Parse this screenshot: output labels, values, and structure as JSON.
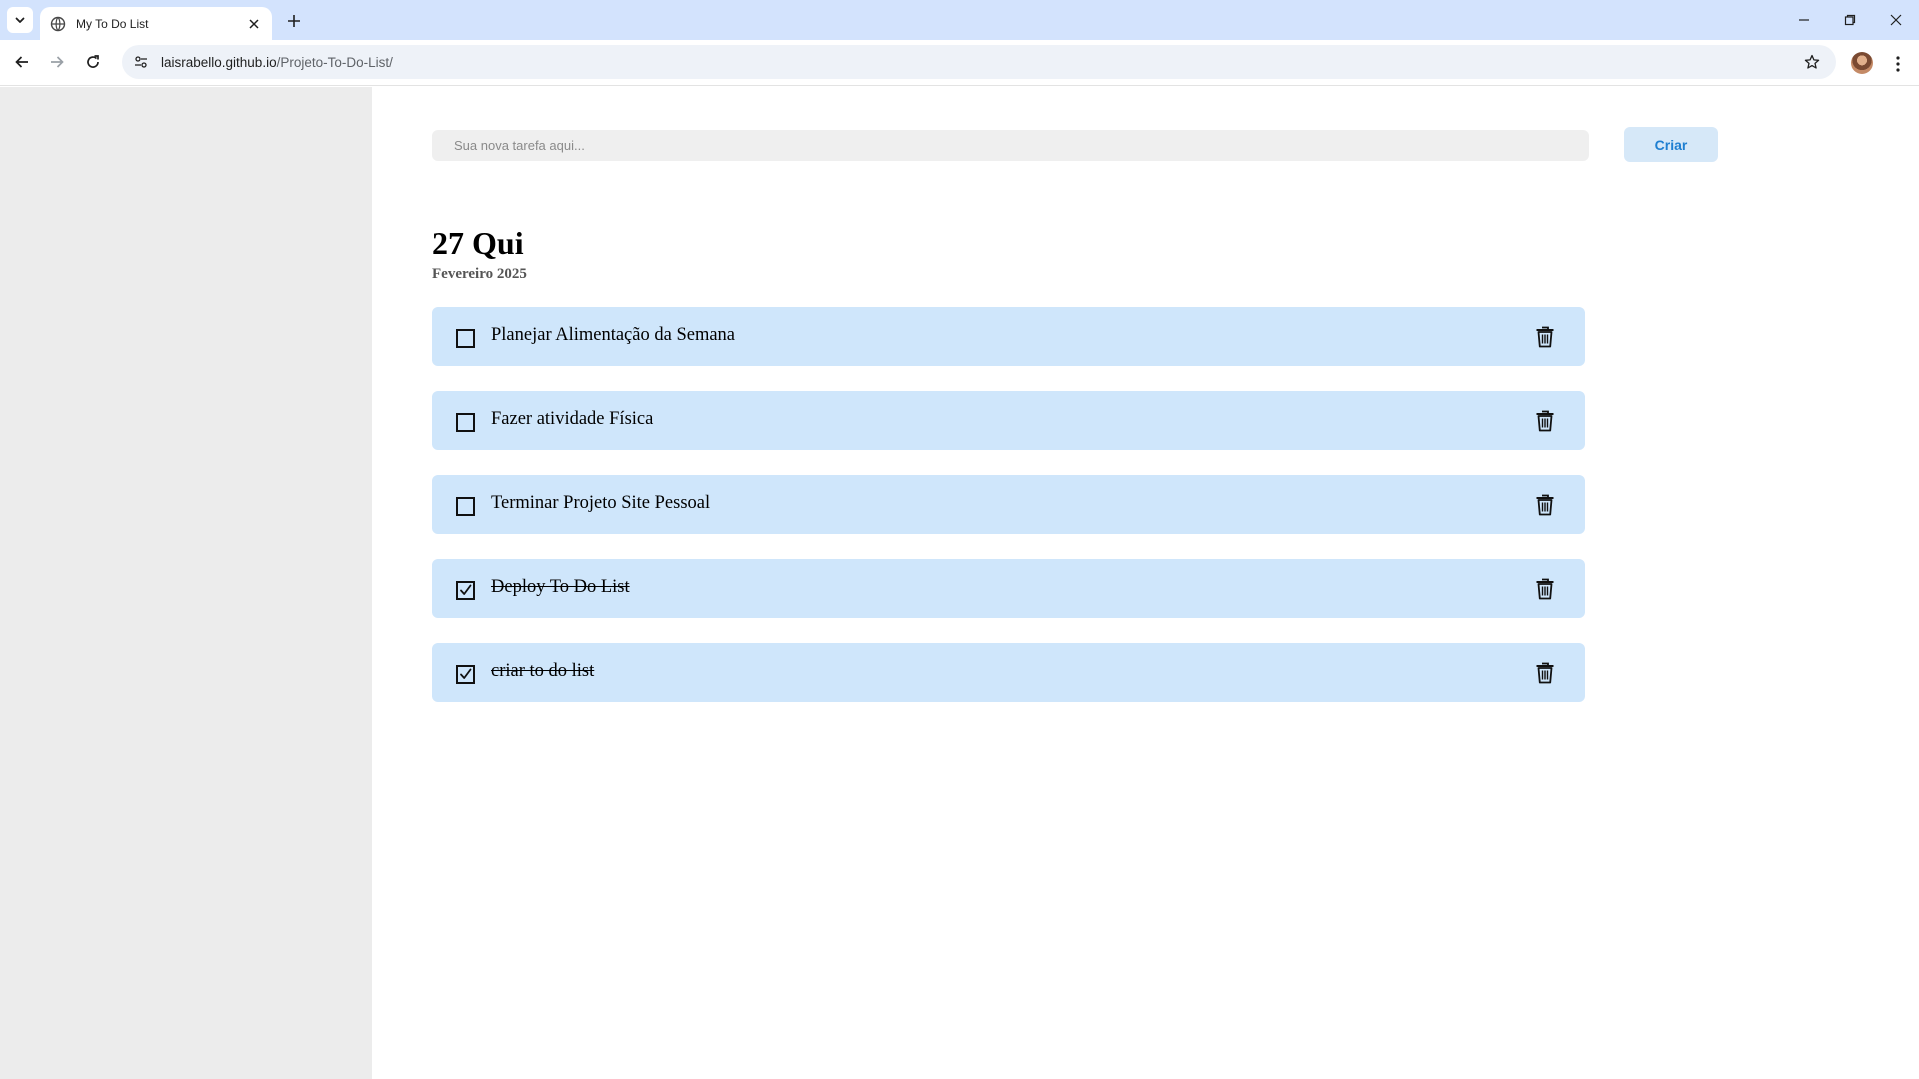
{
  "browser": {
    "tab_title": "My To Do List",
    "url_host": "laisrabello.github.io",
    "url_path": "/Projeto-To-Do-List/"
  },
  "app": {
    "input_placeholder": "Sua nova tarefa aqui...",
    "input_value": "",
    "create_label": "Criar",
    "day": "27 Qui",
    "month": "Fevereiro 2025",
    "tasks": [
      {
        "label": "Planejar Alimentação da Semana",
        "done": false
      },
      {
        "label": "Fazer atividade Física",
        "done": false
      },
      {
        "label": "Terminar Projeto Site Pessoal",
        "done": false
      },
      {
        "label": "Deploy To Do List",
        "done": true
      },
      {
        "label": "criar to do list",
        "done": true
      }
    ]
  },
  "icons": {
    "task_checkbox": "checkbox-icon",
    "task_delete": "trash-icon"
  },
  "colors": {
    "task_bg": "#cfe6fb",
    "create_button_bg": "#d6e8f8",
    "create_button_text": "#1f7fd1",
    "sidebar_bg": "#ececec",
    "tabstrip_bg": "#d3e3fd"
  }
}
